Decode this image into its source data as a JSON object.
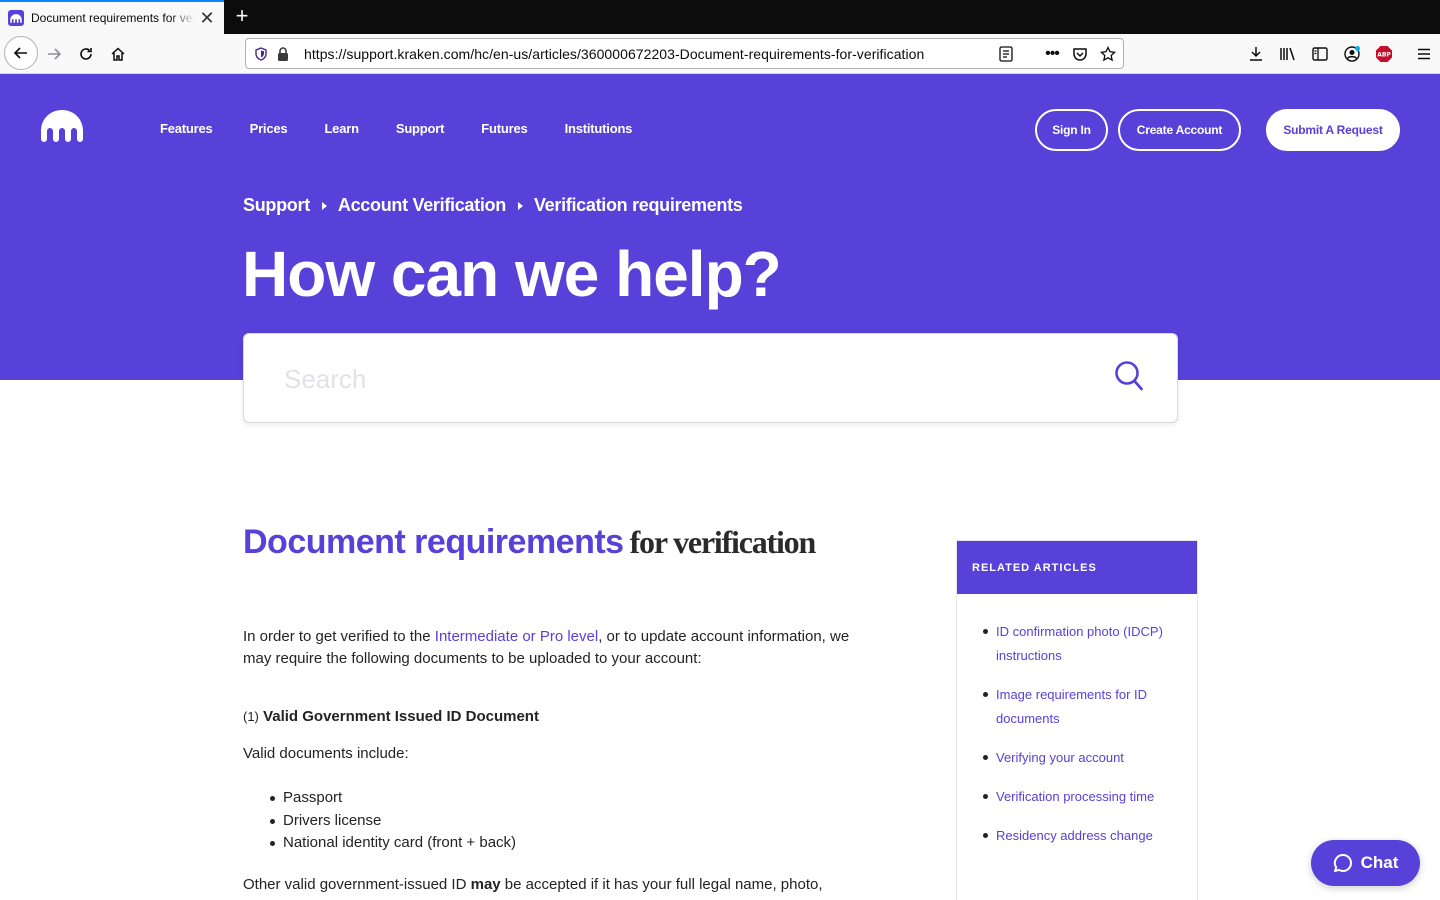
{
  "browser": {
    "tab_title": "Document requirements for verification",
    "url": "https://support.kraken.com/hc/en-us/articles/360000672203-Document-requirements-for-verification",
    "accent": "#0a84ff"
  },
  "nav": {
    "items": [
      "Features",
      "Prices",
      "Learn",
      "Support",
      "Futures",
      "Institutions"
    ],
    "sign_in": "Sign In",
    "create_account": "Create Account",
    "submit_request": "Submit A Request"
  },
  "breadcrumb": [
    "Support",
    "Account Verification",
    "Verification requirements"
  ],
  "hero": {
    "title": "How can we help?",
    "bg_color": "#5741d9"
  },
  "search": {
    "placeholder": "Search"
  },
  "article": {
    "title_main": "Document requirements",
    "title_rest": "for verification",
    "intro_before": "In order to get verified to the ",
    "intro_link": "Intermediate or Pro level",
    "intro_after": ", or to update account information, we may require the following documents to be uploaded to your account:",
    "section_num": "(1)",
    "section_title": "Valid Government Issued ID Document",
    "valid_docs_label": "Valid documents include:",
    "documents": [
      "Passport",
      "Drivers license",
      "National identity card (front + back)"
    ],
    "other_before": "Other valid government-issued ID ",
    "other_bold": "may",
    "other_after": " be accepted if it has your full legal name, photo,"
  },
  "related": {
    "heading": "RELATED ARTICLES",
    "items": [
      "ID confirmation photo (IDCP) instructions",
      "Image requirements for ID documents",
      "Verifying your account",
      "Verification processing time",
      "Residency address change"
    ]
  },
  "chat": {
    "label": "Chat"
  }
}
